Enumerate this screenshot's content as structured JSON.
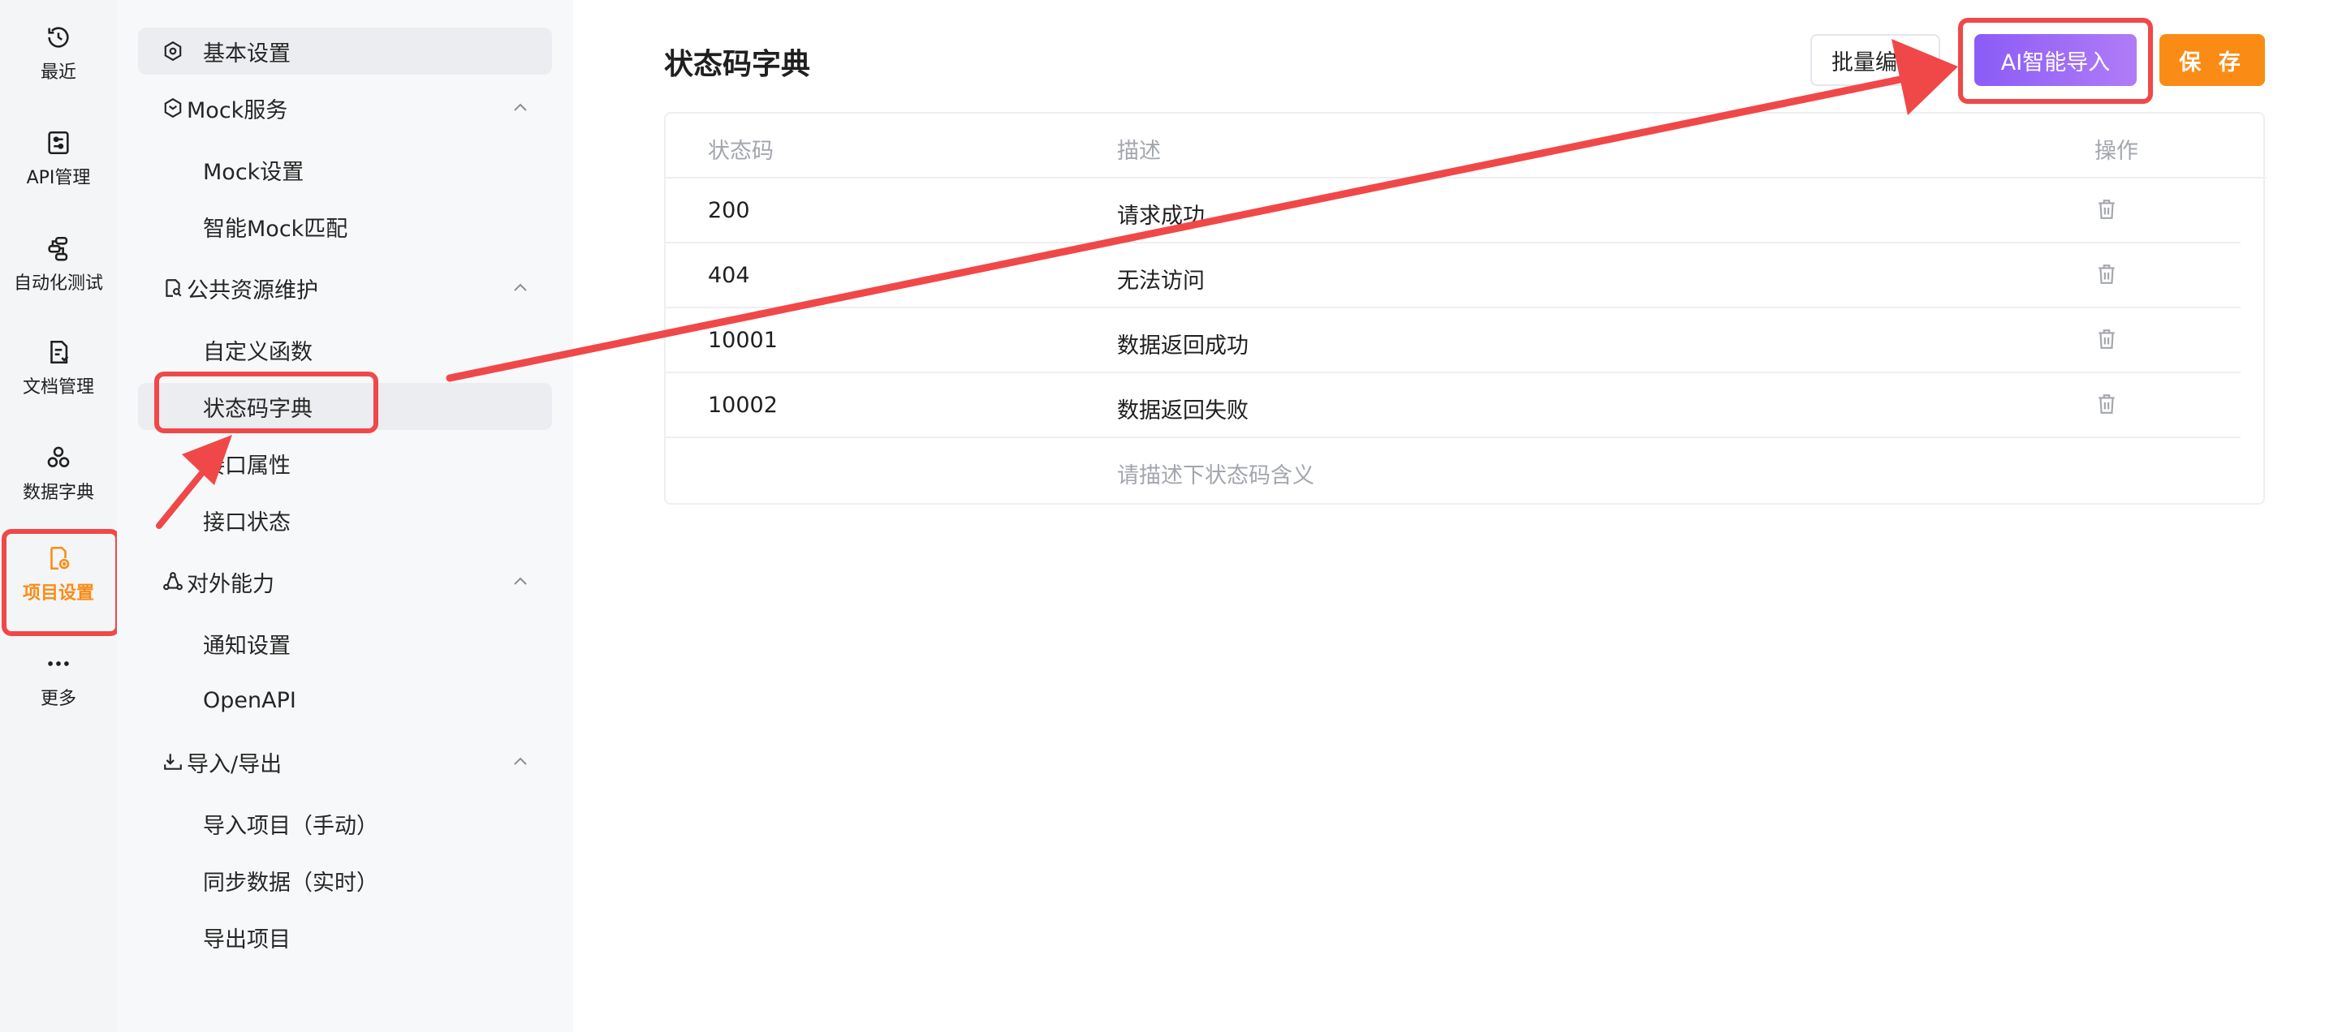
{
  "rail": {
    "items": [
      {
        "label": "最近",
        "icon": "history-icon"
      },
      {
        "label": "API管理",
        "icon": "api-settings-icon"
      },
      {
        "label": "自动化测试",
        "icon": "flow-icon"
      },
      {
        "label": "文档管理",
        "icon": "document-icon"
      },
      {
        "label": "数据字典",
        "icon": "dictionary-icon"
      },
      {
        "label": "项目设置",
        "icon": "project-settings-icon",
        "active": true
      },
      {
        "label": "更多",
        "icon": "more-icon"
      }
    ]
  },
  "menu": {
    "top": {
      "label": "基本设置",
      "icon": "hexagon-settings-icon"
    },
    "groups": [
      {
        "label": "Mock服务",
        "icon": "mock-cube-icon",
        "items": [
          "Mock设置",
          "智能Mock匹配"
        ]
      },
      {
        "label": "公共资源维护",
        "icon": "resource-search-icon",
        "items": [
          "自定义函数",
          "状态码字典",
          "接口属性",
          "接口状态"
        ]
      },
      {
        "label": "对外能力",
        "icon": "share-icon",
        "items": [
          "通知设置",
          "OpenAPI"
        ]
      },
      {
        "label": "导入/导出",
        "icon": "import-export-icon",
        "items": [
          "导入项目（手动）",
          "同步数据（实时）",
          "导出项目"
        ]
      }
    ],
    "selected": "状态码字典"
  },
  "main": {
    "title": "状态码字典",
    "buttons": {
      "batch": "批量编辑",
      "ai": "AI智能导入",
      "save": "保 存"
    },
    "table": {
      "headers": {
        "code": "状态码",
        "desc": "描述",
        "op": "操作"
      },
      "rows": [
        {
          "code": "200",
          "desc": "请求成功"
        },
        {
          "code": "404",
          "desc": "无法访问"
        },
        {
          "code": "10001",
          "desc": "数据返回成功"
        },
        {
          "code": "10002",
          "desc": "数据返回失败"
        }
      ],
      "new_row_placeholder": "请描述下状态码含义"
    }
  },
  "colors": {
    "accent": "#fa8c16",
    "annotation": "#f04848",
    "ai_gradient_start": "#8b5cf6",
    "ai_gradient_end": "#b07cf7"
  }
}
